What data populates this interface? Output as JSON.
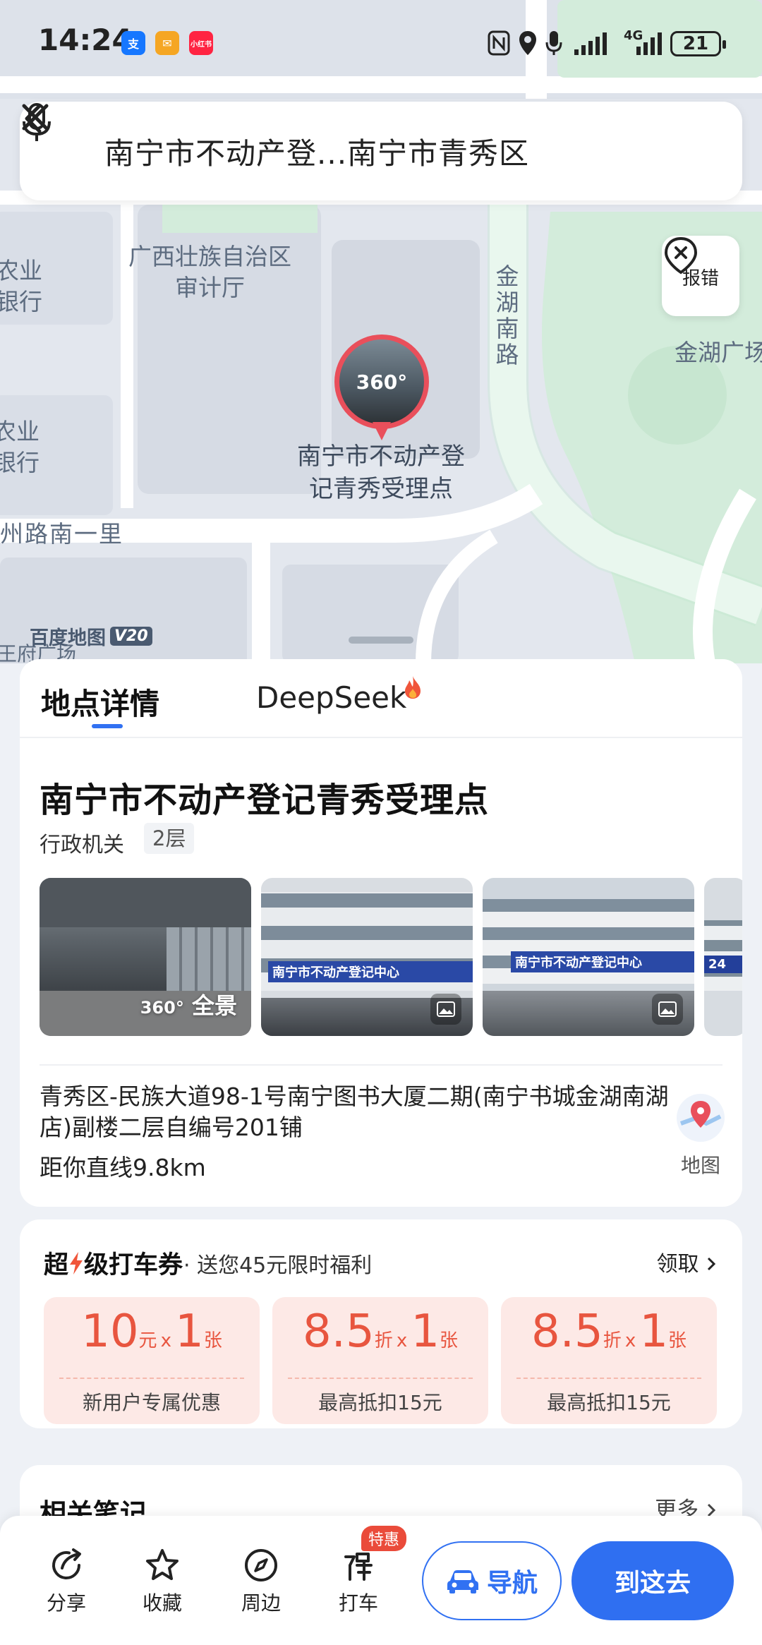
{
  "status_bar": {
    "time": "14:24",
    "app_badges": [
      "支",
      "✉",
      "小红书"
    ],
    "network": "4G",
    "battery": "21"
  },
  "search": {
    "query": "南宁市不动产登...南宁市青秀区",
    "icons": {
      "back": "back-arrow-icon",
      "mic": "microphone-icon",
      "close": "close-icon"
    }
  },
  "map": {
    "labels": [
      {
        "text": "广西壮族自治区\n审计厅"
      },
      {
        "text": "农业\n银行"
      },
      {
        "text": "农业\n银行"
      },
      {
        "text": "州路南一里"
      },
      {
        "text": "金湖南路"
      },
      {
        "text": "金湖广场"
      },
      {
        "text": "王府广场"
      }
    ],
    "pin_badge": "360°",
    "pin_label": "南宁市不动产登\n记青秀受理点",
    "report_label": "报错",
    "logo": "百度地图",
    "logo_version": "V20"
  },
  "tabs": [
    {
      "label": "地点详情",
      "active": true
    },
    {
      "label": "DeepSeek",
      "active": false
    }
  ],
  "place": {
    "title": "南宁市不动产登记青秀受理点",
    "category": "行政机关",
    "floor": "2层",
    "photos": [
      {
        "kind": "panorama",
        "label": "全景",
        "badge": "360°"
      },
      {
        "kind": "photo",
        "sign": "南宁市不动产登记中心"
      },
      {
        "kind": "photo",
        "sign": "南宁市不动产登记中心"
      },
      {
        "kind": "photo",
        "sign": "24"
      }
    ],
    "address": "青秀区-民族大道98-1号南宁图书大厦二期(南宁书城金湖南湖店)副楼二层自编号201铺",
    "distance": "距你直线9.8km",
    "map_link": "地图"
  },
  "coupons": {
    "title_prefix": "超",
    "title_suffix": "级打车券",
    "subtitle": "· 送您45元限时福利",
    "claim": "领取",
    "items": [
      {
        "amount": "10",
        "unit": "元",
        "times": "x",
        "count": "1",
        "count_unit": "张",
        "desc": "新用户专属优惠"
      },
      {
        "amount": "8.5",
        "unit": "折",
        "times": "x",
        "count": "1",
        "count_unit": "张",
        "desc": "最高抵扣15元"
      },
      {
        "amount": "8.5",
        "unit": "折",
        "times": "x",
        "count": "1",
        "count_unit": "张",
        "desc": "最高抵扣15元"
      }
    ]
  },
  "notes": {
    "title": "相关笔记",
    "more": "更多"
  },
  "bottom_bar": {
    "share": "分享",
    "favorite": "收藏",
    "nearby": "周边",
    "taxi": "打车",
    "promo": "特惠",
    "navigate": "导航",
    "go": "到这去"
  },
  "colors": {
    "accent": "#3171f2",
    "pin": "#e94f5b",
    "coupon": "#e8553f",
    "coupon_bg": "#fde9e6",
    "map_green": "#d3ecdb",
    "map_road": "#ffffff"
  }
}
